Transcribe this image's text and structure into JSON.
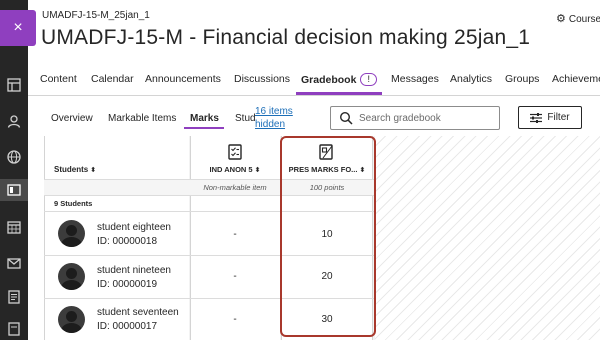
{
  "header": {
    "course_code": "UMADFJ-15-M_25jan_1",
    "course_title": "UMADFJ-15-M - Financial decision making 25jan_1",
    "course_link_label": "Course",
    "close_label": "×"
  },
  "rail": {
    "icons": [
      "panel-icon",
      "profile-icon",
      "globe-icon",
      "courses-icon",
      "calendar-icon",
      "messages-icon",
      "grades-icon",
      "tools-icon"
    ]
  },
  "tabs": [
    {
      "label": "Content"
    },
    {
      "label": "Calendar"
    },
    {
      "label": "Announcements"
    },
    {
      "label": "Discussions"
    },
    {
      "label": "Gradebook",
      "badge": "!",
      "active": true
    },
    {
      "label": "Messages"
    },
    {
      "label": "Analytics"
    },
    {
      "label": "Groups"
    },
    {
      "label": "Achievements"
    }
  ],
  "subtabs": [
    {
      "label": "Overview"
    },
    {
      "label": "Markable Items"
    },
    {
      "label": "Marks",
      "active": true
    },
    {
      "label": "Students"
    }
  ],
  "hidden_items_link": "16 items hidden",
  "search": {
    "placeholder": "Search gradebook"
  },
  "filter_label": "Filter",
  "grid": {
    "students_header": "Students",
    "student_count": "9 Students",
    "columns": [
      {
        "title": "IND ANON 5",
        "subtitle": "Non-markable item"
      },
      {
        "title": "PRES MARKS FO...",
        "subtitle": "100 points"
      }
    ],
    "rows": [
      {
        "name": "student eighteen",
        "id": "ID: 00000018",
        "col1": "-",
        "col2": "10"
      },
      {
        "name": "student nineteen",
        "id": "ID: 00000019",
        "col1": "-",
        "col2": "20"
      },
      {
        "name": "student seventeen",
        "id": "ID: 00000017",
        "col1": "-",
        "col2": "30"
      }
    ]
  },
  "colors": {
    "accent": "#8f3fbf",
    "highlight": "#a8382c",
    "link": "#1d6fb8"
  }
}
